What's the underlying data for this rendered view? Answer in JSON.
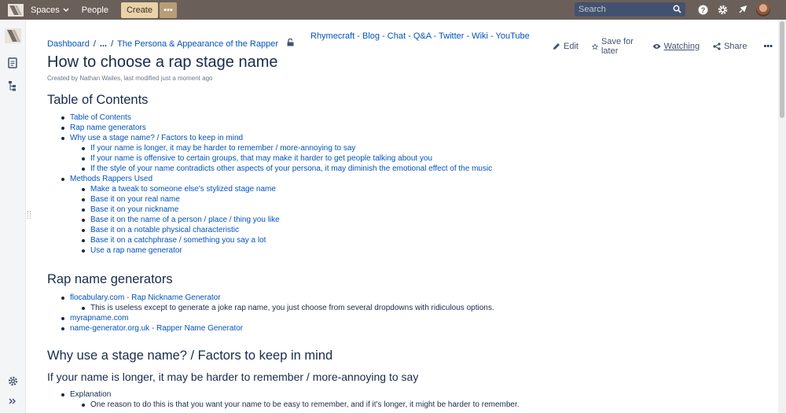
{
  "topbar": {
    "spaces_label": "Spaces",
    "people_label": "People",
    "create_label": "Create",
    "more_label": "•••",
    "search_placeholder": "Search",
    "bg_color": "#6b5f5a",
    "create_color": "#e8d3a8"
  },
  "breadcrumb": {
    "dashboard": "Dashboard",
    "ellipsis": "...",
    "parent": "The Persona & Appearance of the Rapper"
  },
  "header_links": "Rhymecraft - Blog - Chat - Q&A - Twitter - Wiki - YouTube",
  "actions": {
    "edit": "Edit",
    "save": "Save for later",
    "watching": "Watching",
    "share": "Share",
    "more": "•••"
  },
  "page": {
    "title": "How to choose a rap stage name",
    "byline": "Created by Nathan Wailes, last modified just a moment ago"
  },
  "toc": {
    "heading": "Table of Contents",
    "items": [
      {
        "level": 1,
        "text": "Table of Contents"
      },
      {
        "level": 1,
        "text": "Rap name generators"
      },
      {
        "level": 1,
        "text": "Why use a stage name? / Factors to keep in mind"
      },
      {
        "level": 2,
        "text": "If your name is longer, it may be harder to remember / more-annoying to say"
      },
      {
        "level": 2,
        "text": "If your name is offensive to certain groups, that may make it harder to get people talking about you"
      },
      {
        "level": 2,
        "text": "If the style of your name contradicts other aspects of your persona, it may diminish the emotional effect of the music"
      },
      {
        "level": 1,
        "text": "Methods Rappers Used"
      },
      {
        "level": 2,
        "text": "Make a tweak to someone else's stylized stage name"
      },
      {
        "level": 2,
        "text": "Base it on your real name"
      },
      {
        "level": 2,
        "text": "Base it on your nickname"
      },
      {
        "level": 2,
        "text": "Base it on the name of a person / place / thing you like"
      },
      {
        "level": 2,
        "text": "Base it on a notable physical characteristic"
      },
      {
        "level": 2,
        "text": "Base it on a catchphrase / something you say a lot"
      },
      {
        "level": 2,
        "text": "Use a rap name generator"
      }
    ]
  },
  "generators": {
    "heading": "Rap name generators",
    "items": [
      {
        "text": "flocabulary.com - Rap Nickname Generator",
        "note": "This is useless except to generate a joke rap name, you just choose from several dropdowns with ridiculous options."
      },
      {
        "text": "myrapname.com"
      },
      {
        "text": "name-generator.org.uk - Rapper Name Generator"
      }
    ]
  },
  "why": {
    "heading": "Why use a stage name? / Factors to keep in mind",
    "subheading": "If your name is longer, it may be harder to remember / more-annoying to say",
    "explanation_label": "Explanation",
    "explanation_text": "One reason to do this is that you want your name to be easy to remember, and if it's longer, it might be harder to remember."
  }
}
